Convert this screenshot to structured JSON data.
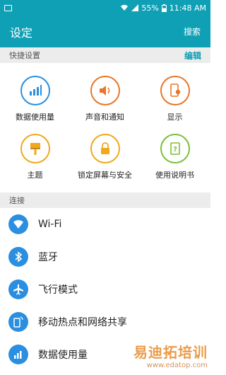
{
  "status": {
    "battery": "55%",
    "time": "11:48 AM"
  },
  "app_bar": {
    "title": "设定",
    "search": "搜索"
  },
  "quick": {
    "header": "快捷设置",
    "edit": "编辑",
    "tiles": [
      {
        "label": "数据使用量",
        "icon": "data-usage-icon",
        "color": "#2a8fe0"
      },
      {
        "label": "声音和通知",
        "icon": "speaker-icon",
        "color": "#e8762a"
      },
      {
        "label": "显示",
        "icon": "display-icon",
        "color": "#e8762a"
      },
      {
        "label": "主题",
        "icon": "paint-brush-icon",
        "color": "#f0a81c"
      },
      {
        "label": "锁定屏幕与安全",
        "icon": "lock-icon",
        "color": "#f0a81c"
      },
      {
        "label": "使用说明书",
        "icon": "help-book-icon",
        "color": "#7bbf3a"
      }
    ]
  },
  "connections": {
    "header": "连接",
    "items": [
      {
        "label": "Wi-Fi",
        "icon": "wifi-icon"
      },
      {
        "label": "蓝牙",
        "icon": "bluetooth-icon"
      },
      {
        "label": "飞行模式",
        "icon": "airplane-icon"
      },
      {
        "label": "移动热点和网络共享",
        "icon": "hotspot-icon"
      },
      {
        "label": "数据使用量",
        "icon": "data-usage-icon"
      }
    ]
  },
  "watermark": {
    "title": "易迪拓培训",
    "url": "www.edatop.com"
  },
  "colors": {
    "accent": "#10a0b6",
    "list_icon": "#2a8fe0"
  }
}
